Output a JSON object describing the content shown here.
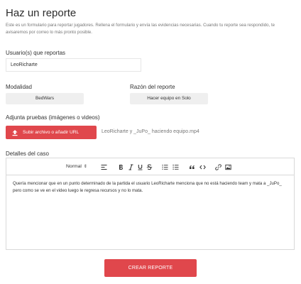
{
  "page": {
    "title": "Haz un reporte",
    "description": "Este es un formulario para reportar jugadores. Rellena el formulario y envía las evidencias necesarias. Cuando tu reporte sea respondido, te avisaremos por correo lo más pronto posible."
  },
  "form": {
    "users_label": "Usuario(s) que reportas",
    "users_value": "LeoRicharte",
    "mode_label": "Modalidad",
    "mode_value": "BedWars",
    "reason_label": "Razón del reporte",
    "reason_value": "Hacer equipo en Solo",
    "proof_label": "Adjunta pruebas (imágenes o videos)",
    "upload_label": "Subir archivo o añadir URL",
    "uploaded_file": "LeoRicharte y _JuPo_ haciendo equipo.mp4",
    "details_label": "Detalles del caso",
    "editor": {
      "size_label": "Normal",
      "content": "Quería mencionar que en un punto determinado de la partida el usuario LeoRicharte menciona que no está haciendo team y mata a _JuPo_ pero como se ve en el video luego le regresa recursos y no lo mata."
    },
    "submit_label": "CREAR REPORTE"
  },
  "colors": {
    "accent": "#e0474c",
    "select_bg": "#efefef"
  },
  "icons": [
    "upload-icon",
    "align-icon",
    "bold-icon",
    "italic-icon",
    "underline-icon",
    "strikethrough-icon",
    "ordered-list-icon",
    "bullet-list-icon",
    "quote-icon",
    "code-icon",
    "link-icon",
    "image-icon"
  ]
}
